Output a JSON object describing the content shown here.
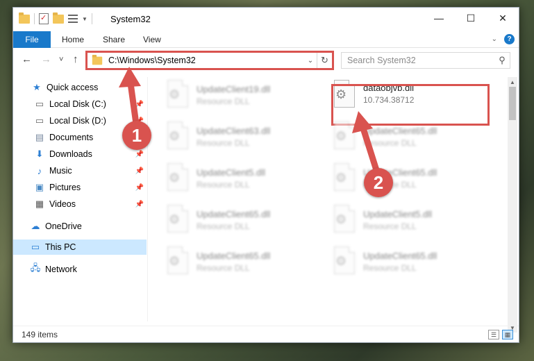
{
  "window": {
    "title": "System32",
    "controls": {
      "minimize": "—",
      "maximize": "☐",
      "close": "✕"
    }
  },
  "ribbon": {
    "tabs": [
      "File",
      "Home",
      "Share",
      "View"
    ],
    "help_label": "?"
  },
  "navigation": {
    "back": "←",
    "forward": "→",
    "recent": "˅",
    "up": "↑",
    "address": "C:\\Windows\\System32",
    "search_placeholder": "Search System32"
  },
  "sidebar": {
    "items": [
      {
        "label": "Quick access",
        "icon": "star-icon",
        "pinned": false
      },
      {
        "label": "Local Disk (C:)",
        "icon": "drive-icon",
        "pinned": true
      },
      {
        "label": "Local Disk (D:)",
        "icon": "drive-icon",
        "pinned": true
      },
      {
        "label": "Documents",
        "icon": "documents-icon",
        "pinned": true
      },
      {
        "label": "Downloads",
        "icon": "downloads-icon",
        "pinned": true
      },
      {
        "label": "Music",
        "icon": "music-icon",
        "pinned": true
      },
      {
        "label": "Pictures",
        "icon": "pictures-icon",
        "pinned": true
      },
      {
        "label": "Videos",
        "icon": "videos-icon",
        "pinned": true
      },
      {
        "label": "OneDrive",
        "icon": "cloud-icon",
        "pinned": false
      },
      {
        "label": "This PC",
        "icon": "monitor-icon",
        "pinned": false,
        "selected": true
      },
      {
        "label": "Network",
        "icon": "network-icon",
        "pinned": false
      }
    ]
  },
  "files": [
    {
      "name": "UpdateClient19.dll",
      "sub": "Resource DLL",
      "blurred": true
    },
    {
      "name": "dataobjvb.dll",
      "sub": "10.734.38712",
      "blurred": false,
      "highlighted": true
    },
    {
      "name": "UpdateClient63.dll",
      "sub": "Resource DLL",
      "blurred": true
    },
    {
      "name": "UpdateClient65.dll",
      "sub": "Resource DLL",
      "blurred": true
    },
    {
      "name": "UpdateClient5.dll",
      "sub": "Resource DLL",
      "blurred": true
    },
    {
      "name": "UpdateClient65.dll",
      "sub": "Resource DLL",
      "blurred": true
    },
    {
      "name": "UpdateClient65.dll",
      "sub": "Resource DLL",
      "blurred": true
    },
    {
      "name": "UpdateClient5.dll",
      "sub": "Resource DLL",
      "blurred": true
    },
    {
      "name": "UpdateClient65.dll",
      "sub": "Resource DLL",
      "blurred": true
    },
    {
      "name": "UpdateClient65.dll",
      "sub": "Resource DLL",
      "blurred": true
    }
  ],
  "status": {
    "item_count": "149 items"
  },
  "annotations": {
    "callout_1": "1",
    "callout_2": "2",
    "color": "#d9534f"
  }
}
